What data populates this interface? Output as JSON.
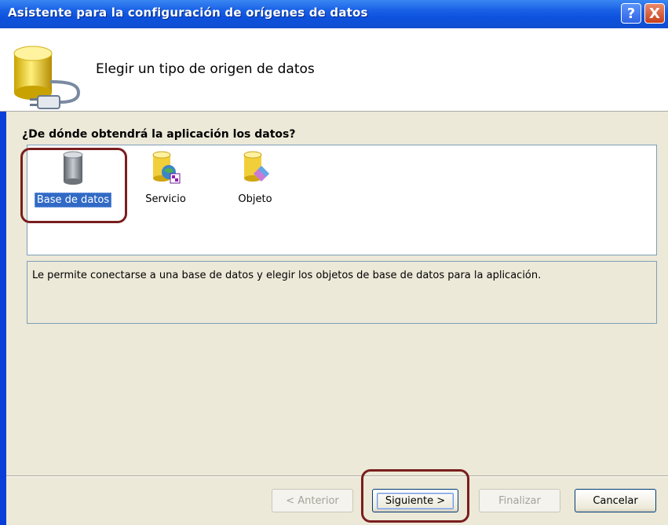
{
  "window": {
    "title": "Asistente para la configuración de orígenes de datos",
    "help_label": "?",
    "close_label": "X"
  },
  "header": {
    "title": "Elegir un tipo de origen de datos",
    "icon": "database-plug-icon"
  },
  "question": "¿De dónde obtendrá la aplicación los datos?",
  "source_types": [
    {
      "label": "Base de datos",
      "icon": "database-icon",
      "selected": true
    },
    {
      "label": "Servicio",
      "icon": "service-icon",
      "selected": false
    },
    {
      "label": "Objeto",
      "icon": "object-icon",
      "selected": false
    }
  ],
  "description": "Le permite conectarse a una base de datos y elegir los objetos de base de datos para la aplicación.",
  "buttons": {
    "previous": "< Anterior",
    "next": "Siguiente >",
    "finish": "Finalizar",
    "cancel": "Cancelar"
  },
  "colors": {
    "title_bar": "#0d52de",
    "selection": "#316ac5",
    "annotation": "#7a1e1e",
    "dialog_face": "#ece9d8"
  }
}
